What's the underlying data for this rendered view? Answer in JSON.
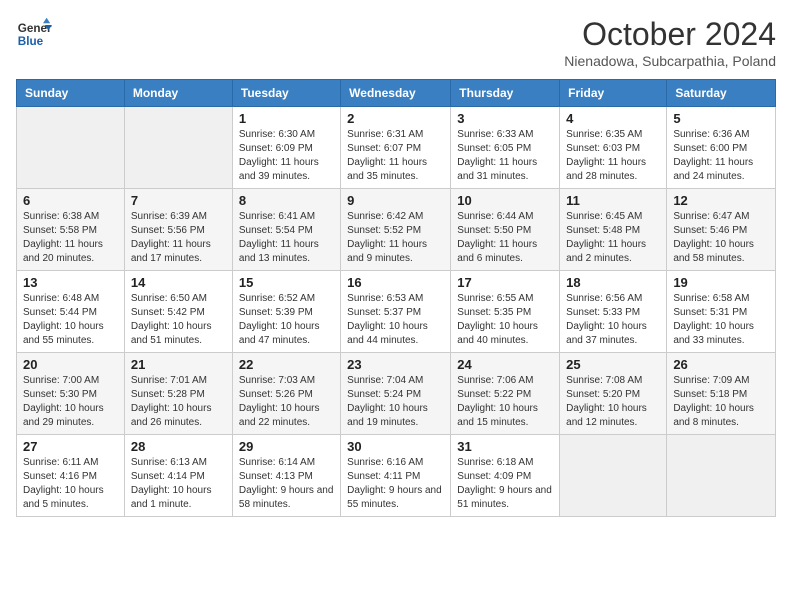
{
  "header": {
    "logo_general": "General",
    "logo_blue": "Blue",
    "month": "October 2024",
    "location": "Nienadowa, Subcarpathia, Poland"
  },
  "days_of_week": [
    "Sunday",
    "Monday",
    "Tuesday",
    "Wednesday",
    "Thursday",
    "Friday",
    "Saturday"
  ],
  "weeks": [
    [
      {
        "day": "",
        "info": ""
      },
      {
        "day": "",
        "info": ""
      },
      {
        "day": "1",
        "info": "Sunrise: 6:30 AM\nSunset: 6:09 PM\nDaylight: 11 hours and 39 minutes."
      },
      {
        "day": "2",
        "info": "Sunrise: 6:31 AM\nSunset: 6:07 PM\nDaylight: 11 hours and 35 minutes."
      },
      {
        "day": "3",
        "info": "Sunrise: 6:33 AM\nSunset: 6:05 PM\nDaylight: 11 hours and 31 minutes."
      },
      {
        "day": "4",
        "info": "Sunrise: 6:35 AM\nSunset: 6:03 PM\nDaylight: 11 hours and 28 minutes."
      },
      {
        "day": "5",
        "info": "Sunrise: 6:36 AM\nSunset: 6:00 PM\nDaylight: 11 hours and 24 minutes."
      }
    ],
    [
      {
        "day": "6",
        "info": "Sunrise: 6:38 AM\nSunset: 5:58 PM\nDaylight: 11 hours and 20 minutes."
      },
      {
        "day": "7",
        "info": "Sunrise: 6:39 AM\nSunset: 5:56 PM\nDaylight: 11 hours and 17 minutes."
      },
      {
        "day": "8",
        "info": "Sunrise: 6:41 AM\nSunset: 5:54 PM\nDaylight: 11 hours and 13 minutes."
      },
      {
        "day": "9",
        "info": "Sunrise: 6:42 AM\nSunset: 5:52 PM\nDaylight: 11 hours and 9 minutes."
      },
      {
        "day": "10",
        "info": "Sunrise: 6:44 AM\nSunset: 5:50 PM\nDaylight: 11 hours and 6 minutes."
      },
      {
        "day": "11",
        "info": "Sunrise: 6:45 AM\nSunset: 5:48 PM\nDaylight: 11 hours and 2 minutes."
      },
      {
        "day": "12",
        "info": "Sunrise: 6:47 AM\nSunset: 5:46 PM\nDaylight: 10 hours and 58 minutes."
      }
    ],
    [
      {
        "day": "13",
        "info": "Sunrise: 6:48 AM\nSunset: 5:44 PM\nDaylight: 10 hours and 55 minutes."
      },
      {
        "day": "14",
        "info": "Sunrise: 6:50 AM\nSunset: 5:42 PM\nDaylight: 10 hours and 51 minutes."
      },
      {
        "day": "15",
        "info": "Sunrise: 6:52 AM\nSunset: 5:39 PM\nDaylight: 10 hours and 47 minutes."
      },
      {
        "day": "16",
        "info": "Sunrise: 6:53 AM\nSunset: 5:37 PM\nDaylight: 10 hours and 44 minutes."
      },
      {
        "day": "17",
        "info": "Sunrise: 6:55 AM\nSunset: 5:35 PM\nDaylight: 10 hours and 40 minutes."
      },
      {
        "day": "18",
        "info": "Sunrise: 6:56 AM\nSunset: 5:33 PM\nDaylight: 10 hours and 37 minutes."
      },
      {
        "day": "19",
        "info": "Sunrise: 6:58 AM\nSunset: 5:31 PM\nDaylight: 10 hours and 33 minutes."
      }
    ],
    [
      {
        "day": "20",
        "info": "Sunrise: 7:00 AM\nSunset: 5:30 PM\nDaylight: 10 hours and 29 minutes."
      },
      {
        "day": "21",
        "info": "Sunrise: 7:01 AM\nSunset: 5:28 PM\nDaylight: 10 hours and 26 minutes."
      },
      {
        "day": "22",
        "info": "Sunrise: 7:03 AM\nSunset: 5:26 PM\nDaylight: 10 hours and 22 minutes."
      },
      {
        "day": "23",
        "info": "Sunrise: 7:04 AM\nSunset: 5:24 PM\nDaylight: 10 hours and 19 minutes."
      },
      {
        "day": "24",
        "info": "Sunrise: 7:06 AM\nSunset: 5:22 PM\nDaylight: 10 hours and 15 minutes."
      },
      {
        "day": "25",
        "info": "Sunrise: 7:08 AM\nSunset: 5:20 PM\nDaylight: 10 hours and 12 minutes."
      },
      {
        "day": "26",
        "info": "Sunrise: 7:09 AM\nSunset: 5:18 PM\nDaylight: 10 hours and 8 minutes."
      }
    ],
    [
      {
        "day": "27",
        "info": "Sunrise: 6:11 AM\nSunset: 4:16 PM\nDaylight: 10 hours and 5 minutes."
      },
      {
        "day": "28",
        "info": "Sunrise: 6:13 AM\nSunset: 4:14 PM\nDaylight: 10 hours and 1 minute."
      },
      {
        "day": "29",
        "info": "Sunrise: 6:14 AM\nSunset: 4:13 PM\nDaylight: 9 hours and 58 minutes."
      },
      {
        "day": "30",
        "info": "Sunrise: 6:16 AM\nSunset: 4:11 PM\nDaylight: 9 hours and 55 minutes."
      },
      {
        "day": "31",
        "info": "Sunrise: 6:18 AM\nSunset: 4:09 PM\nDaylight: 9 hours and 51 minutes."
      },
      {
        "day": "",
        "info": ""
      },
      {
        "day": "",
        "info": ""
      }
    ]
  ]
}
